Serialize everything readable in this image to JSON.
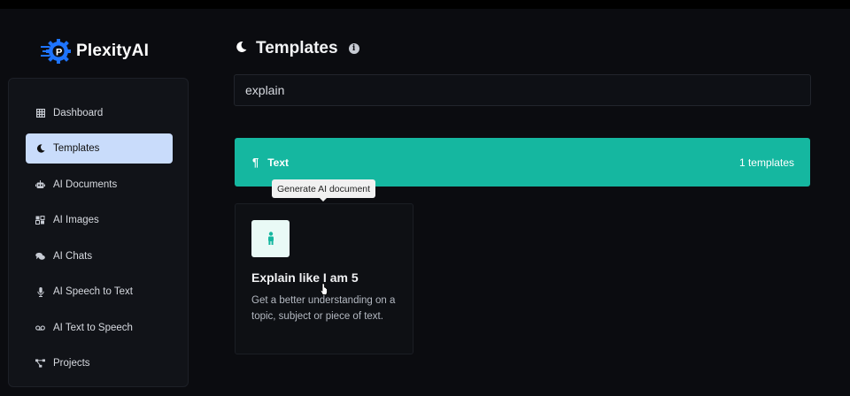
{
  "brand": {
    "name": "PlexityAI",
    "logo_icon": "gear-p-logo",
    "accent": "#1e74ff"
  },
  "sidebar": {
    "items": [
      {
        "label": "Dashboard",
        "icon": "grid-icon",
        "active": false
      },
      {
        "label": "Templates",
        "icon": "moon-icon",
        "active": true
      },
      {
        "label": "AI Documents",
        "icon": "robot-icon",
        "active": false
      },
      {
        "label": "AI Images",
        "icon": "images-icon",
        "active": false
      },
      {
        "label": "AI Chats",
        "icon": "chat-icon",
        "active": false
      },
      {
        "label": "AI Speech to Text",
        "icon": "microphone-icon",
        "active": false
      },
      {
        "label": "AI Text to Speech",
        "icon": "voicemail-icon",
        "active": false
      },
      {
        "label": "Projects",
        "icon": "project-diagram-icon",
        "active": false
      }
    ]
  },
  "header": {
    "title": "Templates",
    "icon": "moon-icon",
    "info_icon": "info-icon"
  },
  "search": {
    "value": "explain",
    "placeholder": ""
  },
  "category": {
    "name": "Text",
    "icon": "pilcrow-icon",
    "count_label": "1 templates",
    "color": "#15b7a0"
  },
  "tooltip": {
    "text": "Generate AI document"
  },
  "card": {
    "icon": "child-icon",
    "title": "Explain like I am 5",
    "description": "Get a better understanding on a topic, subject or piece of text."
  }
}
